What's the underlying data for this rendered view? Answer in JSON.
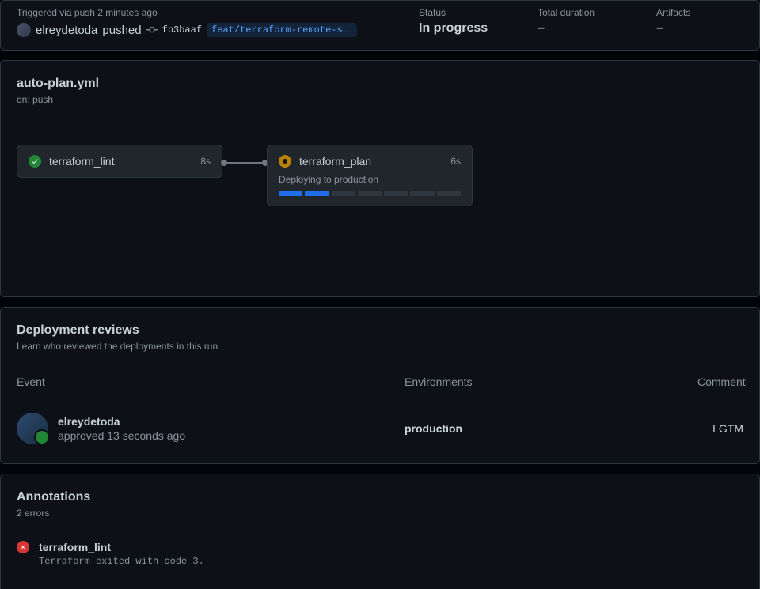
{
  "header": {
    "trigger_text": "Triggered via push 2 minutes ago",
    "actor": "elreydetoda",
    "pushed_label": "pushed",
    "commit_sha": "fb3baaf",
    "branch": "feat/terraform-remote-sta…",
    "status_label": "Status",
    "status_value": "In progress",
    "duration_label": "Total duration",
    "duration_value": "–",
    "artifacts_label": "Artifacts",
    "artifacts_value": "–"
  },
  "workflow": {
    "name": "auto-plan.yml",
    "on": "on: push",
    "jobs": [
      {
        "name": "terraform_lint",
        "duration": "8s",
        "status": "success"
      },
      {
        "name": "terraform_plan",
        "duration": "6s",
        "status": "running",
        "sub": "Deploying to production"
      }
    ]
  },
  "reviews": {
    "title": "Deployment reviews",
    "sub": "Learn who reviewed the deployments in this run",
    "headers": {
      "event": "Event",
      "env": "Environments",
      "comment": "Comment"
    },
    "rows": [
      {
        "user": "elreydetoda",
        "action": "approved 13 seconds ago",
        "env": "production",
        "comment": "LGTM"
      }
    ]
  },
  "annotations": {
    "title": "Annotations",
    "sub": "2 errors",
    "items": [
      {
        "title": "terraform_lint",
        "msg": "Terraform exited with code 3."
      }
    ]
  }
}
